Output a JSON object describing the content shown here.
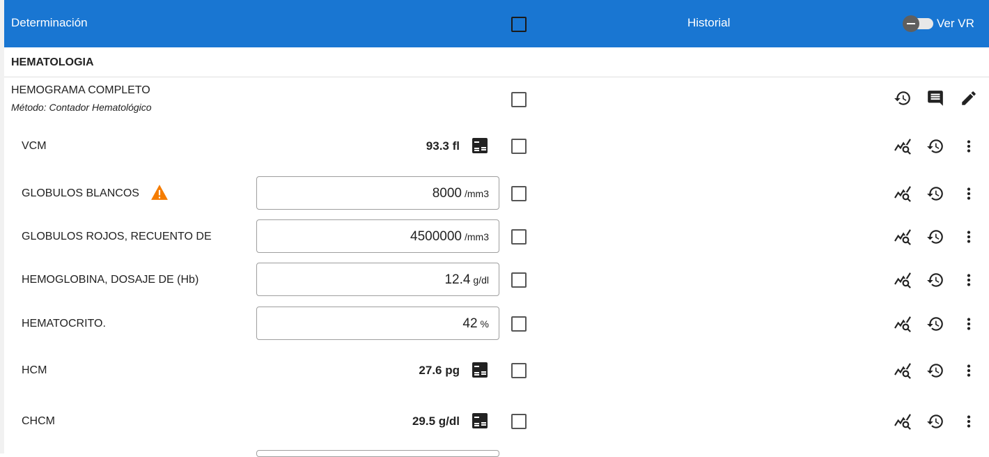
{
  "header": {
    "title": "Determinación",
    "historial": "Historial",
    "ver_vr": "Ver VR"
  },
  "section": {
    "title": "HEMATOLOGIA"
  },
  "group": {
    "title": "HEMOGRAMA COMPLETO",
    "method": "Método: Contador Hematológico"
  },
  "rows": [
    {
      "name": "VCM",
      "value": "93.3 fl"
    },
    {
      "name": "GLOBULOS BLANCOS",
      "value": "8000",
      "unit": "/mm3"
    },
    {
      "name": "GLOBULOS ROJOS, RECUENTO DE",
      "value": "4500000",
      "unit": "/mm3"
    },
    {
      "name": "HEMOGLOBINA, DOSAJE DE (Hb)",
      "value": "12.4",
      "unit": "g/dl"
    },
    {
      "name": "HEMATOCRITO.",
      "value": "42",
      "unit": "%"
    },
    {
      "name": "HCM",
      "value": "27.6 pg"
    },
    {
      "name": "CHCM",
      "value": "29.5 g/dl"
    }
  ],
  "colors": {
    "header": "#1976d2",
    "warning": "#f57c00"
  }
}
